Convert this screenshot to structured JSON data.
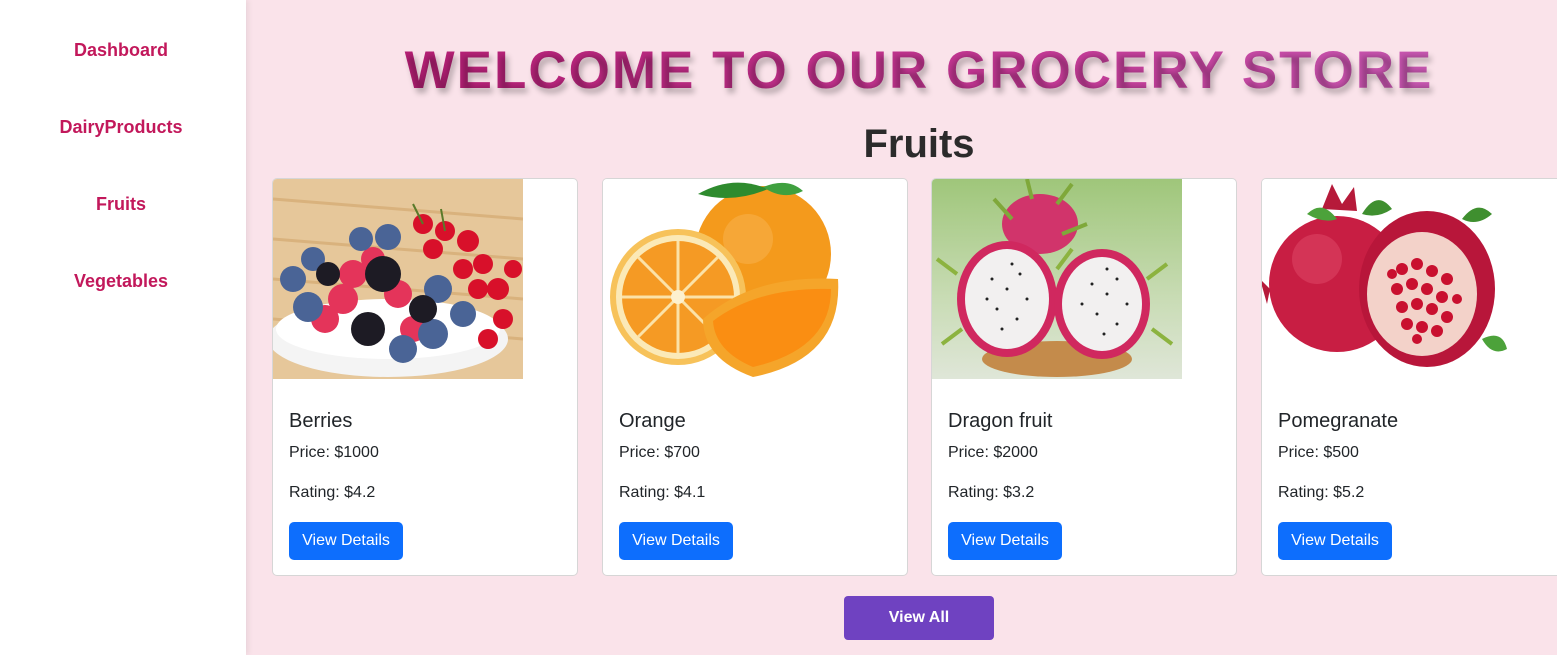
{
  "sidebar": {
    "items": [
      {
        "label": "Dashboard"
      },
      {
        "label": "DairyProducts"
      },
      {
        "label": "Fruits"
      },
      {
        "label": "Vegetables"
      }
    ]
  },
  "main": {
    "welcome_title": "WELCOME TO OUR GROCERY STORE",
    "section_title": "Fruits",
    "view_all_label": "View All"
  },
  "products": [
    {
      "name": "Berries",
      "price": "Price: $1000",
      "rating": "Rating: $4.2",
      "button": "View Details",
      "image": "berries-image"
    },
    {
      "name": "Orange",
      "price": "Price: $700",
      "rating": "Rating: $4.1",
      "button": "View Details",
      "image": "orange-image"
    },
    {
      "name": "Dragon fruit",
      "price": "Price: $2000",
      "rating": "Rating: $3.2",
      "button": "View Details",
      "image": "dragon-fruit-image"
    },
    {
      "name": "Pomegranate",
      "price": "Price: $500",
      "rating": "Rating: $5.2",
      "button": "View Details",
      "image": "pomegranate-image"
    }
  ],
  "colors": {
    "accent": "#c2185b",
    "background": "#fae3ea",
    "primary_button": "#0d6efd",
    "view_all_button": "#6f42c1"
  }
}
